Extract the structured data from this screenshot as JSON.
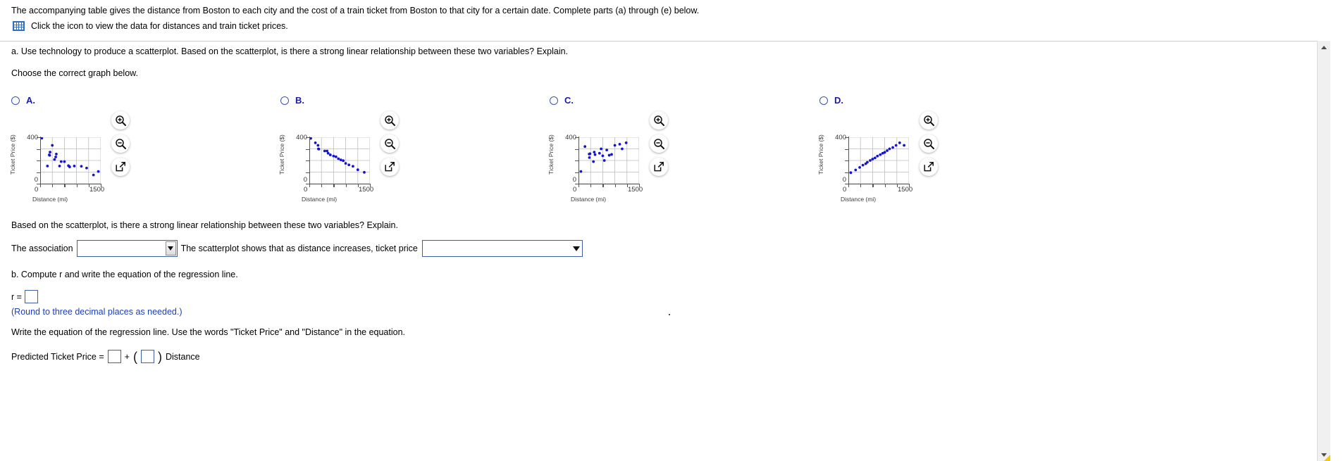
{
  "header": {
    "intro": "The accompanying table gives the distance from Boston to each city and the cost of a train ticket from Boston to that city for a certain date. Complete parts (a) through (e) below.",
    "icon_link_text": "Click the icon to view the data for distances and train ticket prices.",
    "icon_name": "table-icon"
  },
  "question_a": {
    "prompt": "a. Use technology to produce a scatterplot. Based on the scatterplot, is there a strong linear relationship between these two variables? Explain.",
    "choose": "Choose the correct graph below."
  },
  "options": [
    {
      "letter": "A."
    },
    {
      "letter": "B."
    },
    {
      "letter": "C."
    },
    {
      "letter": "D."
    }
  ],
  "tools": {
    "zoom_in": "zoom-in-icon",
    "zoom_out": "zoom-out-icon",
    "expand": "open-in-new-window-icon"
  },
  "followup": {
    "based_text": "Based on the scatterplot, is there a strong linear relationship between these two variables? Explain.",
    "assoc_prefix": "The association",
    "assoc_select_value": "",
    "mid_text": "The scatterplot shows that as distance increases, ticket price",
    "trend_select_value": ""
  },
  "question_b": {
    "prompt": "b. Compute r and write the equation of the regression line.",
    "r_label": "r =",
    "r_value": "",
    "round_note": "(Round to three decimal places as needed.)",
    "write_eq": "Write the equation of the regression line. Use the words \"Ticket Price\" and \"Distance\" in the equation.",
    "pred_label": "Predicted Ticket Price =",
    "intercept_value": "",
    "plus": "+",
    "paren_open": "(",
    "paren_close": ")",
    "slope_value": "",
    "distance_word": "Distance"
  },
  "chart_data": [
    {
      "type": "scatter",
      "option": "A",
      "title": "",
      "xlabel": "Distance (mi)",
      "ylabel": "Ticket Price ($)",
      "xlim": [
        0,
        1500
      ],
      "ylim": [
        0,
        400
      ],
      "xticks": [
        0,
        1500
      ],
      "xticklabels": [
        "0",
        "1500"
      ],
      "yticks": [
        0,
        400
      ],
      "yticklabels": [
        "0",
        "400"
      ],
      "grid": true,
      "grid_cols": 5,
      "grid_rows": 4,
      "points": [
        [
          40,
          392
        ],
        [
          300,
          330
        ],
        [
          245,
          272
        ],
        [
          225,
          248
        ],
        [
          235,
          244
        ],
        [
          400,
          255
        ],
        [
          385,
          230
        ],
        [
          355,
          208
        ],
        [
          520,
          190
        ],
        [
          600,
          190
        ],
        [
          180,
          152
        ],
        [
          480,
          152
        ],
        [
          700,
          155
        ],
        [
          730,
          145
        ],
        [
          845,
          152
        ],
        [
          1020,
          150
        ],
        [
          1150,
          135
        ],
        [
          1320,
          75
        ],
        [
          1440,
          105
        ]
      ]
    },
    {
      "type": "scatter",
      "option": "B",
      "title": "",
      "xlabel": "Distance (mi)",
      "ylabel": "Ticket Price ($)",
      "xlim": [
        0,
        1500
      ],
      "ylim": [
        0,
        400
      ],
      "xticks": [
        0,
        1500
      ],
      "xticklabels": [
        "0",
        "1500"
      ],
      "yticks": [
        0,
        400
      ],
      "yticklabels": [
        "0",
        "400"
      ],
      "grid": true,
      "grid_cols": 5,
      "grid_rows": 4,
      "points": [
        [
          35,
          390
        ],
        [
          150,
          352
        ],
        [
          215,
          330
        ],
        [
          225,
          300
        ],
        [
          235,
          298
        ],
        [
          380,
          282
        ],
        [
          440,
          282
        ],
        [
          465,
          262
        ],
        [
          520,
          248
        ],
        [
          600,
          238
        ],
        [
          660,
          232
        ],
        [
          720,
          215
        ],
        [
          780,
          205
        ],
        [
          840,
          198
        ],
        [
          900,
          175
        ],
        [
          980,
          162
        ],
        [
          1080,
          150
        ],
        [
          1200,
          120
        ],
        [
          1360,
          98
        ]
      ]
    },
    {
      "type": "scatter",
      "option": "C",
      "title": "",
      "xlabel": "Distance (mi)",
      "ylabel": "Ticket Price ($)",
      "xlim": [
        0,
        1500
      ],
      "ylim": [
        0,
        400
      ],
      "xticks": [
        0,
        1500
      ],
      "xticklabels": [
        "0",
        "1500"
      ],
      "yticks": [
        0,
        400
      ],
      "yticklabels": [
        "0",
        "400"
      ],
      "grid": true,
      "grid_cols": 5,
      "grid_rows": 4,
      "points": [
        [
          60,
          105
        ],
        [
          160,
          320
        ],
        [
          265,
          255
        ],
        [
          285,
          258
        ],
        [
          270,
          225
        ],
        [
          390,
          272
        ],
        [
          410,
          250
        ],
        [
          370,
          190
        ],
        [
          520,
          262
        ],
        [
          560,
          300
        ],
        [
          600,
          240
        ],
        [
          640,
          200
        ],
        [
          700,
          290
        ],
        [
          760,
          245
        ],
        [
          820,
          252
        ],
        [
          900,
          330
        ],
        [
          1020,
          340
        ],
        [
          1080,
          300
        ],
        [
          1180,
          352
        ]
      ]
    },
    {
      "type": "scatter",
      "option": "D",
      "title": "",
      "xlabel": "Distance (mi)",
      "ylabel": "Ticket Price ($)",
      "xlim": [
        0,
        1500
      ],
      "ylim": [
        0,
        400
      ],
      "xticks": [
        0,
        1500
      ],
      "xticklabels": [
        "0",
        "1500"
      ],
      "yticks": [
        0,
        400
      ],
      "yticklabels": [
        "0",
        "400"
      ],
      "grid": true,
      "grid_cols": 5,
      "grid_rows": 4,
      "points": [
        [
          60,
          95
        ],
        [
          180,
          118
        ],
        [
          280,
          140
        ],
        [
          360,
          160
        ],
        [
          430,
          172
        ],
        [
          470,
          185
        ],
        [
          540,
          200
        ],
        [
          600,
          212
        ],
        [
          660,
          222
        ],
        [
          720,
          238
        ],
        [
          790,
          250
        ],
        [
          850,
          262
        ],
        [
          900,
          270
        ],
        [
          960,
          285
        ],
        [
          1020,
          300
        ],
        [
          1100,
          312
        ],
        [
          1180,
          330
        ],
        [
          1270,
          352
        ],
        [
          1380,
          330
        ]
      ]
    }
  ]
}
